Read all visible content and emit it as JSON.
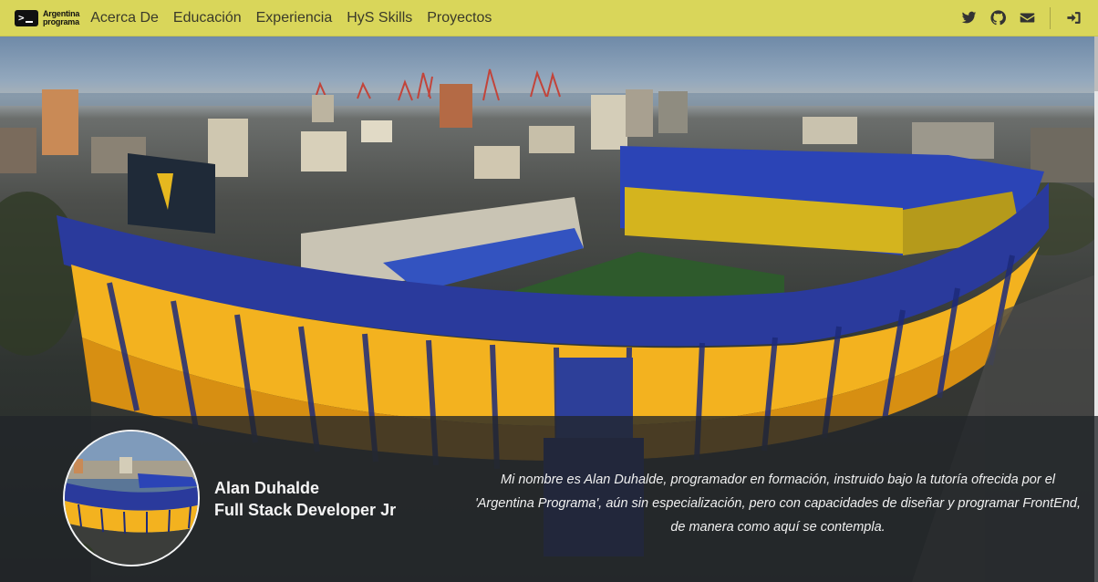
{
  "brand": {
    "line1": "Argentina",
    "line2": "programa",
    "icon": "terminal-icon"
  },
  "nav": {
    "items": [
      {
        "label": "Acerca De"
      },
      {
        "label": "Educación"
      },
      {
        "label": "Experiencia"
      },
      {
        "label": "HyS Skills"
      },
      {
        "label": "Proyectos"
      }
    ],
    "icons": [
      "twitter-icon",
      "github-icon",
      "envelope-icon",
      "sign-in-icon"
    ]
  },
  "profile": {
    "name": "Alan Duhalde",
    "role": "Full Stack Developer Jr"
  },
  "bio": "Mi nombre es Alan Duhalde, programador en formación, instruido bajo la tutoría ofrecida por el 'Argentina Programa', aún sin especialización, pero con capacidades de diseñar y programar FrontEnd, de manera como aquí se contempla.",
  "colors": {
    "navbar": "#d9d65a",
    "panel": "#212529",
    "stadium_blue": "#2a3a9c",
    "stadium_yellow": "#f3b21f",
    "pitch": "#2e5a2c"
  }
}
